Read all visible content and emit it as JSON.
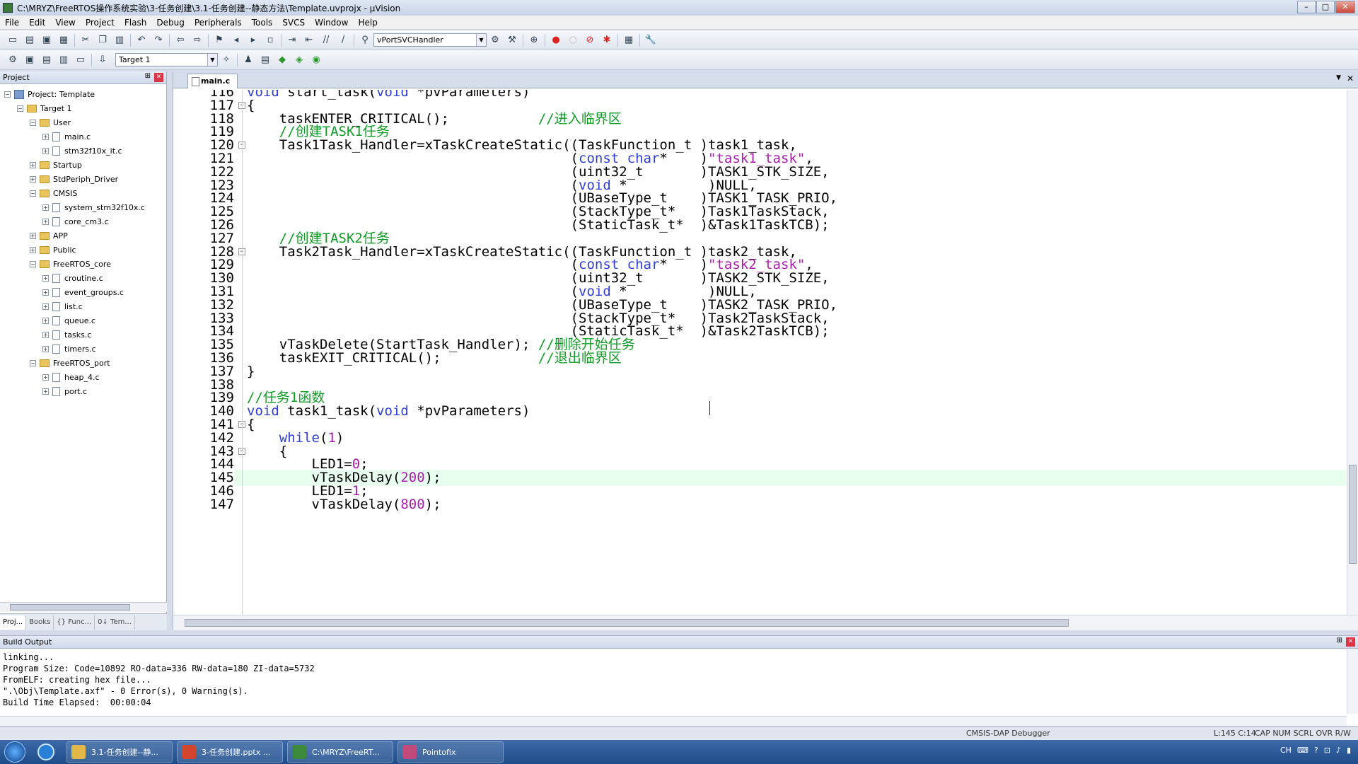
{
  "window": {
    "title": "C:\\MRYZ\\FreeRTOS操作系统实验\\3-任务创建\\3.1-任务创建--静态方法\\Template.uvprojx - µVision"
  },
  "menu": [
    "File",
    "Edit",
    "View",
    "Project",
    "Flash",
    "Debug",
    "Peripherals",
    "Tools",
    "SVCS",
    "Window",
    "Help"
  ],
  "toolbar": {
    "function_combo": "vPortSVCHandler",
    "target_combo": "Target 1"
  },
  "project_panel": {
    "title": "Project",
    "tree": [
      {
        "label": "Project: Template",
        "level": 0,
        "kind": "project",
        "exp": "−"
      },
      {
        "label": "Target 1",
        "level": 1,
        "kind": "folder",
        "exp": "−"
      },
      {
        "label": "User",
        "level": 2,
        "kind": "folder",
        "exp": "−"
      },
      {
        "label": "main.c",
        "level": 3,
        "kind": "file",
        "exp": "+"
      },
      {
        "label": "stm32f10x_it.c",
        "level": 3,
        "kind": "file",
        "exp": "+"
      },
      {
        "label": "Startup",
        "level": 2,
        "kind": "folder",
        "exp": "+"
      },
      {
        "label": "StdPeriph_Driver",
        "level": 2,
        "kind": "folder",
        "exp": "+"
      },
      {
        "label": "CMSIS",
        "level": 2,
        "kind": "folder",
        "exp": "−"
      },
      {
        "label": "system_stm32f10x.c",
        "level": 3,
        "kind": "file",
        "exp": "+"
      },
      {
        "label": "core_cm3.c",
        "level": 3,
        "kind": "file",
        "exp": "+"
      },
      {
        "label": "APP",
        "level": 2,
        "kind": "folder",
        "exp": "+"
      },
      {
        "label": "Public",
        "level": 2,
        "kind": "folder",
        "exp": "+"
      },
      {
        "label": "FreeRTOS_core",
        "level": 2,
        "kind": "folder",
        "exp": "−"
      },
      {
        "label": "croutine.c",
        "level": 3,
        "kind": "file",
        "exp": "+"
      },
      {
        "label": "event_groups.c",
        "level": 3,
        "kind": "file",
        "exp": "+"
      },
      {
        "label": "list.c",
        "level": 3,
        "kind": "file",
        "exp": "+"
      },
      {
        "label": "queue.c",
        "level": 3,
        "kind": "file",
        "exp": "+"
      },
      {
        "label": "tasks.c",
        "level": 3,
        "kind": "file",
        "exp": "+"
      },
      {
        "label": "timers.c",
        "level": 3,
        "kind": "file",
        "exp": "+"
      },
      {
        "label": "FreeRTOS_port",
        "level": 2,
        "kind": "folder",
        "exp": "−"
      },
      {
        "label": "heap_4.c",
        "level": 3,
        "kind": "file",
        "exp": "+"
      },
      {
        "label": "port.c",
        "level": 3,
        "kind": "file",
        "exp": "+"
      }
    ],
    "tabs": [
      "Proj...",
      "Books",
      "{} Func...",
      "0↓ Tem..."
    ]
  },
  "editor": {
    "file_tab": "main.c",
    "lines": [
      {
        "n": "116",
        "fold": "",
        "hl": false,
        "seg": [
          [
            "kw",
            "void"
          ],
          [
            "",
            "start_task("
          ],
          [
            "kw",
            "void"
          ],
          [
            "",
            "*pvParameters)"
          ]
        ]
      },
      {
        "n": "117",
        "fold": "−",
        "hl": false,
        "seg": [
          [
            "",
            "{"
          ]
        ]
      },
      {
        "n": "118",
        "fold": "",
        "hl": false,
        "seg": [
          [
            "",
            "    taskENTER_CRITICAL();           "
          ],
          [
            "cm",
            "//进入临界区"
          ]
        ]
      },
      {
        "n": "119",
        "fold": "",
        "hl": false,
        "seg": [
          [
            "cm",
            "    //创建TASK1任务"
          ]
        ]
      },
      {
        "n": "120",
        "fold": "−",
        "hl": false,
        "seg": [
          [
            "",
            "    Task1Task_Handler=xTaskCreateStatic((TaskFunction_t )task1_task,"
          ]
        ]
      },
      {
        "n": "121",
        "fold": "",
        "hl": false,
        "seg": [
          [
            "",
            "                                        ("
          ],
          [
            "kw",
            "const char"
          ],
          [
            "",
            "*    )"
          ],
          [
            "st",
            "\"task1_task\""
          ],
          [
            "",
            ","
          ]
        ]
      },
      {
        "n": "122",
        "fold": "",
        "hl": false,
        "seg": [
          [
            "",
            "                                        (uint32_t       )TASK1_STK_SIZE,"
          ]
        ]
      },
      {
        "n": "123",
        "fold": "",
        "hl": false,
        "seg": [
          [
            "",
            "                                        ("
          ],
          [
            "kw",
            "void"
          ],
          [
            "",
            "*          )NULL,"
          ]
        ]
      },
      {
        "n": "124",
        "fold": "",
        "hl": false,
        "seg": [
          [
            "",
            "                                        (UBaseType_t    )TASK1_TASK_PRIO,"
          ]
        ]
      },
      {
        "n": "125",
        "fold": "",
        "hl": false,
        "seg": [
          [
            "",
            "                                        (StackType_t*   )Task1TaskStack,"
          ]
        ]
      },
      {
        "n": "126",
        "fold": "",
        "hl": false,
        "seg": [
          [
            "",
            "                                        (StaticTask_t*  )&Task1TaskTCB);"
          ]
        ]
      },
      {
        "n": "127",
        "fold": "",
        "hl": false,
        "seg": [
          [
            "cm",
            "    //创建TASK2任务"
          ]
        ]
      },
      {
        "n": "128",
        "fold": "−",
        "hl": false,
        "seg": [
          [
            "",
            "    Task2Task_Handler=xTaskCreateStatic((TaskFunction_t )task2_task,"
          ]
        ]
      },
      {
        "n": "129",
        "fold": "",
        "hl": false,
        "seg": [
          [
            "",
            "                                        ("
          ],
          [
            "kw",
            "const char"
          ],
          [
            "",
            "*    )"
          ],
          [
            "st",
            "\"task2_task\""
          ],
          [
            "",
            ","
          ]
        ]
      },
      {
        "n": "130",
        "fold": "",
        "hl": false,
        "seg": [
          [
            "",
            "                                        (uint32_t       )TASK2_STK_SIZE,"
          ]
        ]
      },
      {
        "n": "131",
        "fold": "",
        "hl": false,
        "seg": [
          [
            "",
            "                                        ("
          ],
          [
            "kw",
            "void"
          ],
          [
            "",
            "*          )NULL,"
          ]
        ]
      },
      {
        "n": "132",
        "fold": "",
        "hl": false,
        "seg": [
          [
            "",
            "                                        (UBaseType_t    )TASK2_TASK_PRIO,"
          ]
        ]
      },
      {
        "n": "133",
        "fold": "",
        "hl": false,
        "seg": [
          [
            "",
            "                                        (StackType_t*   )Task2TaskStack,"
          ]
        ]
      },
      {
        "n": "134",
        "fold": "",
        "hl": false,
        "seg": [
          [
            "",
            "                                        (StaticTask_t*  )&Task2TaskTCB);"
          ]
        ]
      },
      {
        "n": "135",
        "fold": "",
        "hl": false,
        "seg": [
          [
            "",
            "    vTaskDelete(StartTask_Handler); "
          ],
          [
            "cm",
            "//删除开始任务"
          ]
        ]
      },
      {
        "n": "136",
        "fold": "",
        "hl": false,
        "seg": [
          [
            "",
            "    taskEXIT_CRITICAL();            "
          ],
          [
            "cm",
            "//退出临界区"
          ]
        ]
      },
      {
        "n": "137",
        "fold": "",
        "hl": false,
        "seg": [
          [
            "",
            "}"
          ]
        ]
      },
      {
        "n": "138",
        "fold": "",
        "hl": false,
        "seg": [
          [
            "",
            ""
          ]
        ]
      },
      {
        "n": "139",
        "fold": "",
        "hl": false,
        "seg": [
          [
            "cm",
            "//任务1函数"
          ]
        ]
      },
      {
        "n": "140",
        "fold": "",
        "hl": false,
        "seg": [
          [
            "kw",
            "void"
          ],
          [
            "",
            "task1_task("
          ],
          [
            "kw",
            "void"
          ],
          [
            "",
            "*pvParameters)"
          ]
        ]
      },
      {
        "n": "141",
        "fold": "−",
        "hl": false,
        "seg": [
          [
            "",
            "{"
          ]
        ]
      },
      {
        "n": "142",
        "fold": "",
        "hl": false,
        "seg": [
          [
            "kw",
            "    while"
          ],
          [
            "",
            "("
          ],
          [
            "nm",
            "1"
          ],
          [
            "",
            ")"
          ]
        ]
      },
      {
        "n": "143",
        "fold": "−",
        "hl": false,
        "seg": [
          [
            "",
            "    {"
          ]
        ]
      },
      {
        "n": "144",
        "fold": "",
        "hl": false,
        "seg": [
          [
            "",
            "        LED1="
          ],
          [
            "nm",
            "0"
          ],
          [
            "",
            ";"
          ]
        ]
      },
      {
        "n": "145",
        "fold": "",
        "hl": true,
        "seg": [
          [
            "",
            "        vTaskDelay("
          ],
          [
            "nm",
            "200"
          ],
          [
            "",
            ");"
          ]
        ]
      },
      {
        "n": "146",
        "fold": "",
        "hl": false,
        "seg": [
          [
            "",
            "        LED1="
          ],
          [
            "nm",
            "1"
          ],
          [
            "",
            ";"
          ]
        ]
      },
      {
        "n": "147",
        "fold": "",
        "hl": false,
        "seg": [
          [
            "",
            "        vTaskDelay("
          ],
          [
            "nm",
            "800"
          ],
          [
            "",
            ");"
          ]
        ]
      }
    ]
  },
  "build_output": {
    "title": "Build Output",
    "lines": [
      "linking...",
      "Program Size: Code=10892 RO-data=336 RW-data=180 ZI-data=5732",
      "FromELF: creating hex file...",
      "\".\\Obj\\Template.axf\" - 0 Error(s), 0 Warning(s).",
      "Build Time Elapsed:  00:00:04"
    ]
  },
  "status": {
    "debugger": "CMSIS-DAP Debugger",
    "cursor": "L:145 C:14",
    "flags": "CAP  NUM  SCRL  OVR  R/W"
  },
  "taskbar": {
    "items": [
      {
        "label": "3.1-任务创建--静...",
        "color": "#e2b84a"
      },
      {
        "label": "3-任务创建.pptx ...",
        "color": "#d2452e"
      },
      {
        "label": "C:\\MRYZ\\FreeRT...",
        "color": "#3a8a3a"
      },
      {
        "label": "Pointofix",
        "color": "#c04a7a"
      }
    ],
    "tray": "CH"
  }
}
